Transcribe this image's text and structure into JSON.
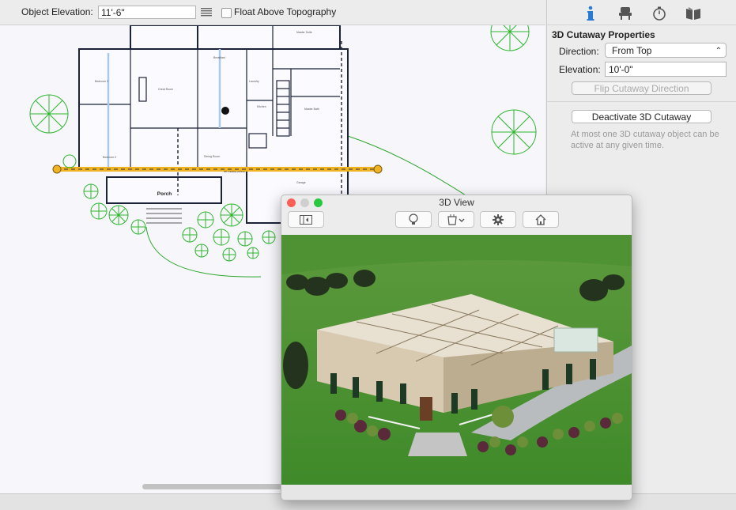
{
  "toolbar": {
    "elevation_label": "Object Elevation:",
    "elevation_value": "11'-6\"",
    "float_label": "Float Above Topography",
    "float_checked": false
  },
  "plan": {
    "labels": {
      "porch": "Porch",
      "cutaway": "3D Cutaway (Active)"
    }
  },
  "panel": {
    "tabs": [
      "info-icon",
      "chair-icon",
      "stopwatch-icon",
      "book-icon"
    ],
    "section_title": "3D Cutaway Properties",
    "direction_label": "Direction:",
    "direction_value": "From Top",
    "elevation_label": "Elevation:",
    "elevation_value": "10'-0\"",
    "flip_button": "Flip Cutaway Direction",
    "deactivate_button": "Deactivate 3D Cutaway",
    "note": "At most one 3D cutaway object can be active at any given time."
  },
  "view3d": {
    "title": "3D View",
    "toolbar": [
      "sidebar-toggle-icon",
      "lightbulb-icon",
      "paint-bucket-icon",
      "gear-icon",
      "home-icon"
    ]
  },
  "colors": {
    "accent_line": "#f0b323",
    "plants": "#2db52d",
    "window_red": "#fc5f57",
    "window_yellow": "#fdbc2e",
    "window_green": "#28c840"
  }
}
